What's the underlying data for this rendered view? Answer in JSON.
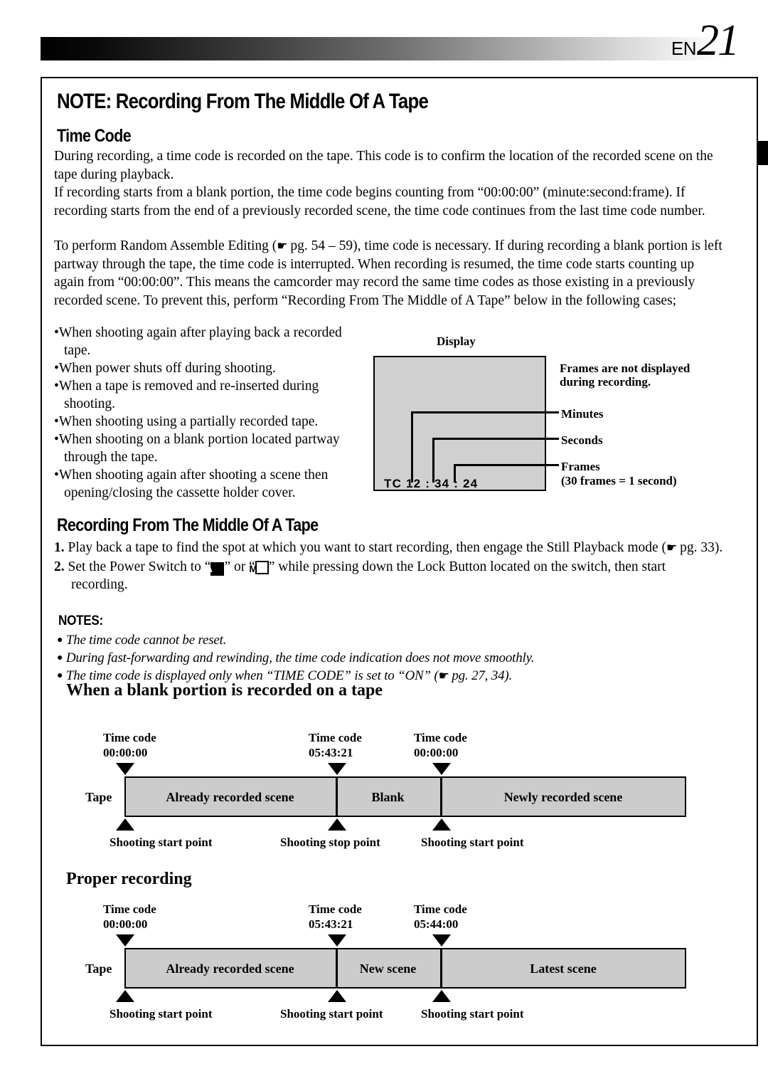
{
  "header": {
    "lang_code": "EN",
    "page_number": "21"
  },
  "title": "NOTE: Recording From The Middle Of A Tape",
  "sections": {
    "time_code": {
      "heading": "Time Code",
      "para1": "During recording, a time code is recorded on the tape. This code is to confirm the location of the recorded scene on the tape during playback.",
      "para2": "If recording starts from a blank portion, the time code begins counting from “00:00:00” (minute:second:frame). If recording starts from the end of a previously recorded scene, the time code continues from the last time code number.",
      "para3_a": "To perform Random Assemble Editing (",
      "para3_b": " pg. 54 – 59), time code is necessary. If during recording a blank portion is left partway through the tape, the time code is interrupted. When recording is resumed, the time code starts counting up again from “00:00:00”. This means the camcorder may record the same time codes as those existing in a previously recorded scene. To prevent this, perform “Recording From The Middle of A Tape” below in the following cases;",
      "bullets": [
        "When shooting again after playing back a recorded tape.",
        "When power shuts off during shooting.",
        "When a tape is removed and re-inserted during shooting.",
        "When shooting using a partially recorded tape.",
        "When shooting on a blank portion located partway through the tape.",
        "When shooting again after shooting a scene then opening/closing the cassette holder cover."
      ]
    },
    "recording_middle": {
      "heading": "Recording From The Middle Of A Tape",
      "step1_num": "1.",
      "step1_a": "Play back a tape to find the spot at which you want to start recording, then engage the Still Playback mode (",
      "step1_b": " pg. 33).",
      "step2_num": "2.",
      "step2_a": "Set the Power Switch to “",
      "step2_icon_a": "A",
      "step2_b": "” or “",
      "step2_icon_m": "M",
      "step2_c": "” while pressing down the Lock Button located on the switch, then start recording."
    },
    "notes": {
      "heading": "NOTES:",
      "items": [
        {
          "text_a": "The time code cannot be reset.",
          "text_b": "",
          "has_hand": false
        },
        {
          "text_a": "During fast-forwarding and rewinding, the time code indication does not move smoothly.",
          "text_b": "",
          "has_hand": false
        },
        {
          "text_a": "The time code is displayed only when “TIME CODE” is set to “ON” (",
          "text_b": " pg. 27, 34).",
          "has_hand": true
        }
      ]
    }
  },
  "display_diagram": {
    "title": "Display",
    "readout": "TC  12 : 34 : 24",
    "callouts": {
      "frames_note_line1": "Frames are not displayed",
      "frames_note_line2": "during recording.",
      "minutes": "Minutes",
      "seconds": "Seconds",
      "frames": "Frames",
      "frames_sub": "(30 frames = 1 second)"
    }
  },
  "tape_diagrams": [
    {
      "heading": "When a blank portion is recorded on a tape",
      "tape_word": "Tape",
      "timecodes": [
        {
          "label": "Time code",
          "value": "00:00:00"
        },
        {
          "label": "Time code",
          "value": "05:43:21"
        },
        {
          "label": "Time code",
          "value": "00:00:00"
        }
      ],
      "segments": [
        "Already recorded scene",
        "Blank",
        "Newly recorded scene"
      ],
      "points": [
        "Shooting start point",
        "Shooting stop point",
        "Shooting start point"
      ]
    },
    {
      "heading": "Proper recording",
      "tape_word": "Tape",
      "timecodes": [
        {
          "label": "Time code",
          "value": "00:00:00"
        },
        {
          "label": "Time code",
          "value": "05:43:21"
        },
        {
          "label": "Time code",
          "value": "05:44:00"
        }
      ],
      "segments": [
        "Already recorded scene",
        "New scene",
        "Latest scene"
      ],
      "points": [
        "Shooting start point",
        "Shooting start point",
        "Shooting start point"
      ]
    }
  ],
  "colors": {
    "tape_fill": "#cccccc",
    "display_fill": "#d0d0d0",
    "ink": "#000000",
    "paper": "#ffffff"
  }
}
